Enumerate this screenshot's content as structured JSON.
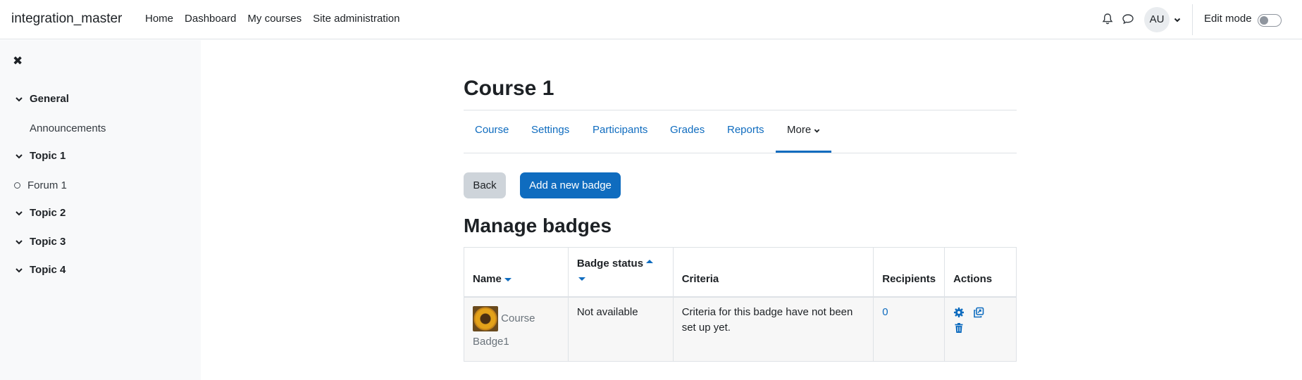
{
  "navbar": {
    "brand": "integration_master",
    "links": [
      "Home",
      "Dashboard",
      "My courses",
      "Site administration"
    ],
    "avatar_initials": "AU",
    "edit_mode_label": "Edit mode",
    "edit_mode_on": false
  },
  "sidebar": {
    "items": [
      {
        "label": "General",
        "type": "section"
      },
      {
        "label": "Announcements",
        "type": "activity-plain"
      },
      {
        "label": "Topic 1",
        "type": "section"
      },
      {
        "label": "Forum 1",
        "type": "activity-circle"
      },
      {
        "label": "Topic 2",
        "type": "section"
      },
      {
        "label": "Topic 3",
        "type": "section"
      },
      {
        "label": "Topic 4",
        "type": "section"
      }
    ]
  },
  "main": {
    "course_title": "Course 1",
    "tabs": [
      "Course",
      "Settings",
      "Participants",
      "Grades",
      "Reports",
      "More"
    ],
    "active_tab": "More",
    "back_label": "Back",
    "add_badge_label": "Add a new badge",
    "section_title": "Manage badges",
    "table": {
      "headers": [
        "Name",
        "Badge status",
        "Criteria",
        "Recipients",
        "Actions"
      ],
      "rows": [
        {
          "name": "Course Badge1",
          "status": "Not available",
          "criteria": "Criteria for this badge have not been set up yet.",
          "recipients": "0"
        }
      ]
    }
  },
  "colors": {
    "link": "#0f6cbf",
    "primary_button": "#0f6cbf",
    "secondary_button": "#ced4da",
    "sidebar_bg": "#f8f9fa",
    "table_row_bg": "#f7f7f7"
  }
}
